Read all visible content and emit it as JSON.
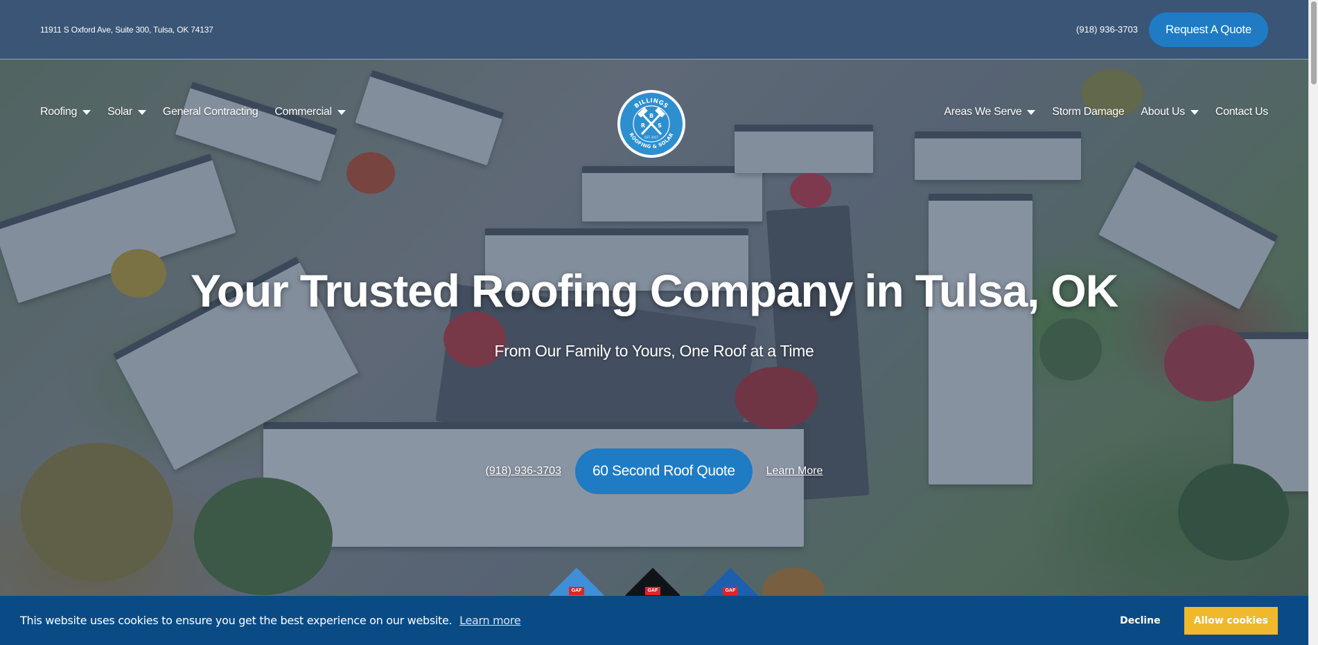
{
  "topbar": {
    "address": "11911 S Oxford Ave, Suite 300, Tulsa, OK 74137",
    "phone": "(918) 936-3703",
    "quote_button": "Request A Quote"
  },
  "nav": {
    "left": [
      {
        "label": "Roofing",
        "dropdown": true
      },
      {
        "label": "Solar",
        "dropdown": true
      },
      {
        "label": "General Contracting",
        "dropdown": false
      },
      {
        "label": "Commercial",
        "dropdown": true
      }
    ],
    "right": [
      {
        "label": "Areas We Serve",
        "dropdown": true
      },
      {
        "label": "Storm Damage",
        "dropdown": false
      },
      {
        "label": "About Us",
        "dropdown": true
      },
      {
        "label": "Contact Us",
        "dropdown": false
      }
    ]
  },
  "logo": {
    "top_text": "BILLINGS",
    "letters": [
      "B",
      "R",
      "S"
    ],
    "est": "EST. 2017",
    "bottom_text": "ROOFING & SOLAR"
  },
  "hero": {
    "headline": "Your Trusted Roofing Company in Tulsa, OK",
    "subline": "From Our Family to Yours, One Roof at a Time",
    "phone_link": "(918) 936-3703",
    "cta_button": "60 Second Roof Quote",
    "learn_more": "Learn More"
  },
  "badges": [
    "GAF",
    "GAF",
    "GAF"
  ],
  "cookie": {
    "message": "This website uses cookies to ensure you get the best experience on our website.",
    "learn_more": "Learn more",
    "decline": "Decline",
    "allow": "Allow cookies"
  },
  "colors": {
    "topbar": "#3a5575",
    "primary_button": "#1e7bc4",
    "cookie_banner": "#0a4b85",
    "allow_button": "#f0b92b"
  }
}
